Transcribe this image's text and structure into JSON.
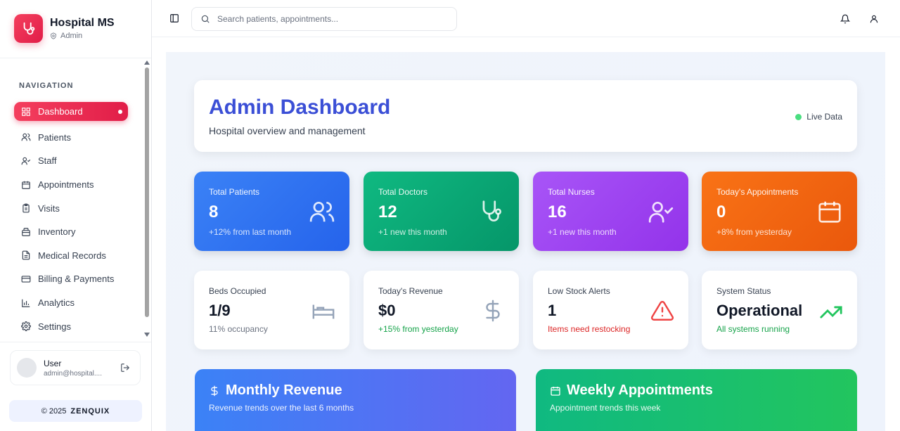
{
  "brand": {
    "title": "Hospital MS",
    "role": "Admin"
  },
  "nav": {
    "heading": "NAVIGATION",
    "items": [
      {
        "label": "Dashboard",
        "icon": "grid-icon"
      },
      {
        "label": "Patients",
        "icon": "users-icon"
      },
      {
        "label": "Staff",
        "icon": "user-check-icon"
      },
      {
        "label": "Appointments",
        "icon": "calendar-icon"
      },
      {
        "label": "Visits",
        "icon": "clipboard-icon"
      },
      {
        "label": "Inventory",
        "icon": "package-icon"
      },
      {
        "label": "Medical Records",
        "icon": "file-text-icon"
      },
      {
        "label": "Billing & Payments",
        "icon": "credit-card-icon"
      },
      {
        "label": "Analytics",
        "icon": "bar-chart-icon"
      },
      {
        "label": "Settings",
        "icon": "gear-icon"
      }
    ]
  },
  "user": {
    "name": "User",
    "email": "admin@hospital...."
  },
  "footer": {
    "copyright": "© 2025",
    "brand": "ZENQUIX"
  },
  "search": {
    "placeholder": "Search patients, appointments..."
  },
  "hero": {
    "title": "Admin Dashboard",
    "subtitle": "Hospital overview and management",
    "live": "Live Data"
  },
  "stats": [
    {
      "label": "Total Patients",
      "value": "8",
      "note": "+12% from last month"
    },
    {
      "label": "Total Doctors",
      "value": "12",
      "note": "+1 new this month"
    },
    {
      "label": "Total Nurses",
      "value": "16",
      "note": "+1 new this month"
    },
    {
      "label": "Today's Appointments",
      "value": "0",
      "note": "+8% from yesterday"
    }
  ],
  "stats2": [
    {
      "label": "Beds Occupied",
      "value": "1/9",
      "note": "11% occupancy"
    },
    {
      "label": "Today's Revenue",
      "value": "$0",
      "note": "+15% from yesterday"
    },
    {
      "label": "Low Stock Alerts",
      "value": "1",
      "note": "Items need restocking"
    },
    {
      "label": "System Status",
      "value": "Operational",
      "note": "All systems running"
    }
  ],
  "panels": {
    "revenue": {
      "title": "Monthly Revenue",
      "subtitle": "Revenue trends over the last 6 months"
    },
    "appointments": {
      "title": "Weekly Appointments",
      "subtitle": "Appointment trends this week"
    }
  },
  "colors": {
    "accent": "#e11d48",
    "heroTitle": "#3b4fd6",
    "positive": "#16a34a",
    "alert": "#dc2626"
  }
}
